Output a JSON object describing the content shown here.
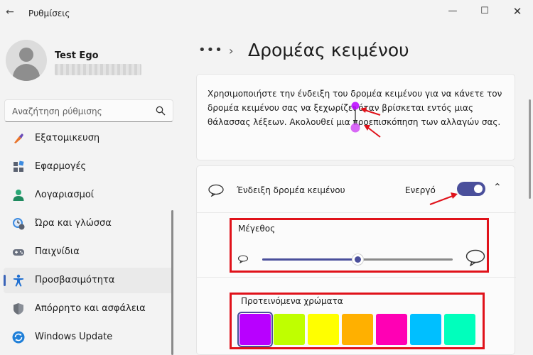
{
  "window": {
    "title": "Ρυθμίσεις",
    "back_glyph": "←",
    "minimize_glyph": "—",
    "maximize_glyph": "☐",
    "close_glyph": "✕"
  },
  "user": {
    "name": "Test Ego"
  },
  "search": {
    "placeholder": "Αναζήτηση ρύθμισης"
  },
  "sidebar": {
    "items": [
      {
        "label": "Εξατομικευση",
        "icon": "brush-icon"
      },
      {
        "label": "Εφαρμογές",
        "icon": "apps-icon"
      },
      {
        "label": "Λογαριασμοί",
        "icon": "person-icon"
      },
      {
        "label": "Ώρα και γλώσσα",
        "icon": "clock-globe-icon"
      },
      {
        "label": "Παιχνίδια",
        "icon": "gamepad-icon"
      },
      {
        "label": "Προσβασιμότητα",
        "icon": "accessibility-icon",
        "selected": true
      },
      {
        "label": "Απόρρητο και ασφάλεια",
        "icon": "shield-icon"
      },
      {
        "label": "Windows Update",
        "icon": "update-icon"
      }
    ]
  },
  "breadcrumb": {
    "dots": "•••",
    "chevron": "›"
  },
  "page": {
    "title": "Δρομέας κειμένου",
    "description": "Χρησιμοποιήστε την ένδειξη του δρομέα κειμένου για να κάνετε τον δρομέα κειμένου σας να ξεχωρίζει όταν βρίσκεται εντός μιας θάλασσας λέξεων. Ακολουθεί μια προεπισκόπηση των αλλαγών σας."
  },
  "indicator_setting": {
    "label": "Ένδειξη δρομέα κειμένου",
    "state_label": "Ενεργό",
    "toggle_on": true,
    "expand_glyph": "⌃"
  },
  "size": {
    "label": "Μέγεθος",
    "value_fraction": 0.5
  },
  "colors": {
    "label": "Προτεινόμενα χρώματα",
    "swatches": [
      "#b800ff",
      "#bfff00",
      "#ffff00",
      "#ffb000",
      "#ff00b4",
      "#00bfff",
      "#00ffbc"
    ],
    "selected_index": 0
  },
  "accent": "#4a4f9b",
  "annotation_color": "#e0121a"
}
